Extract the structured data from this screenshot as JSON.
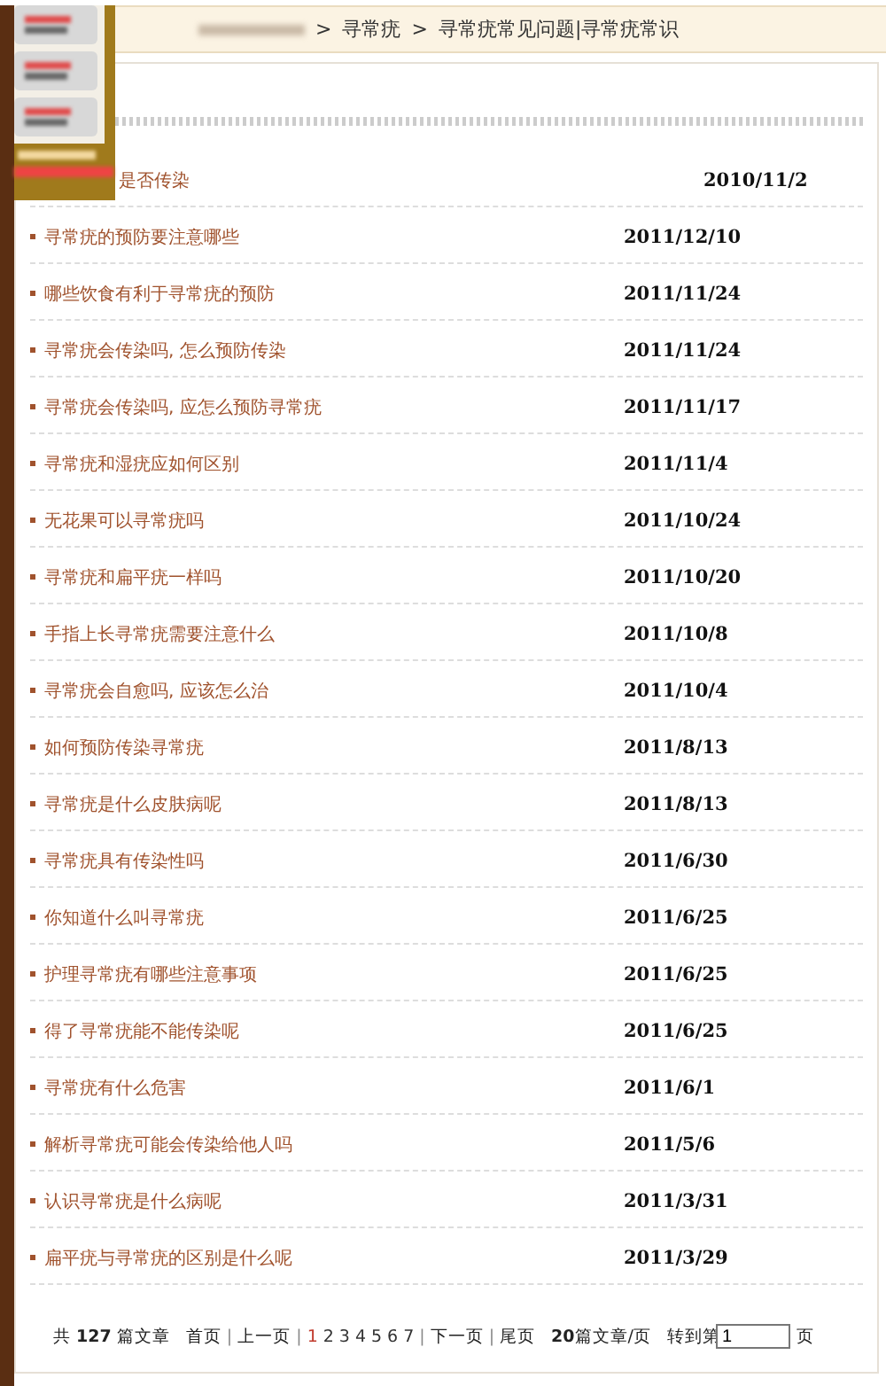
{
  "breadcrumb": {
    "items": [
      {
        "chevron": ">",
        "label": "寻常疣"
      },
      {
        "chevron": ">",
        "label": "寻常疣常见问题|寻常疣常识"
      }
    ]
  },
  "articles": [
    {
      "title": "是否传染",
      "date": "2010/11/2"
    },
    {
      "title": "寻常疣的预防要注意哪些",
      "date": "2011/12/10"
    },
    {
      "title": "哪些饮食有利于寻常疣的预防",
      "date": "2011/11/24"
    },
    {
      "title": "寻常疣会传染吗, 怎么预防传染",
      "date": "2011/11/24"
    },
    {
      "title": "寻常疣会传染吗, 应怎么预防寻常疣",
      "date": "2011/11/17"
    },
    {
      "title": "寻常疣和湿疣应如何区别",
      "date": "2011/11/4"
    },
    {
      "title": "无花果可以寻常疣吗",
      "date": "2011/10/24"
    },
    {
      "title": "寻常疣和扁平疣一样吗",
      "date": "2011/10/20"
    },
    {
      "title": "手指上长寻常疣需要注意什么",
      "date": "2011/10/8"
    },
    {
      "title": "寻常疣会自愈吗, 应该怎么治",
      "date": "2011/10/4"
    },
    {
      "title": "如何预防传染寻常疣",
      "date": "2011/8/13"
    },
    {
      "title": "寻常疣是什么皮肤病呢",
      "date": "2011/8/13"
    },
    {
      "title": "寻常疣具有传染性吗",
      "date": "2011/6/30"
    },
    {
      "title": "你知道什么叫寻常疣",
      "date": "2011/6/25"
    },
    {
      "title": "护理寻常疣有哪些注意事项",
      "date": "2011/6/25"
    },
    {
      "title": "得了寻常疣能不能传染呢",
      "date": "2011/6/25"
    },
    {
      "title": "寻常疣有什么危害",
      "date": "2011/6/1"
    },
    {
      "title": "解析寻常疣可能会传染给他人吗",
      "date": "2011/5/6"
    },
    {
      "title": "认识寻常疣是什么病呢",
      "date": "2011/3/31"
    },
    {
      "title": "扁平疣与寻常疣的区别是什么呢",
      "date": "2011/3/29"
    }
  ],
  "pagination": {
    "separators": [
      "|",
      "|",
      "|",
      "|"
    ],
    "total_prefix": "共",
    "total": "127",
    "total_suffix": "篇文章",
    "first": "首页",
    "prev": "上一页",
    "pages": [
      {
        "label": "1",
        "selected": true
      },
      {
        "label": "2",
        "selected": false
      },
      {
        "label": "3",
        "selected": false
      },
      {
        "label": "4",
        "selected": false
      },
      {
        "label": "5",
        "selected": false
      },
      {
        "label": "6",
        "selected": false
      },
      {
        "label": "7",
        "selected": false
      }
    ],
    "next": "下一页",
    "last": "尾页",
    "per_page": "20",
    "per_page_suffix": "篇文章/页",
    "goto_prefix": "转到第",
    "goto_value": "1",
    "goto_suffix": "页"
  }
}
